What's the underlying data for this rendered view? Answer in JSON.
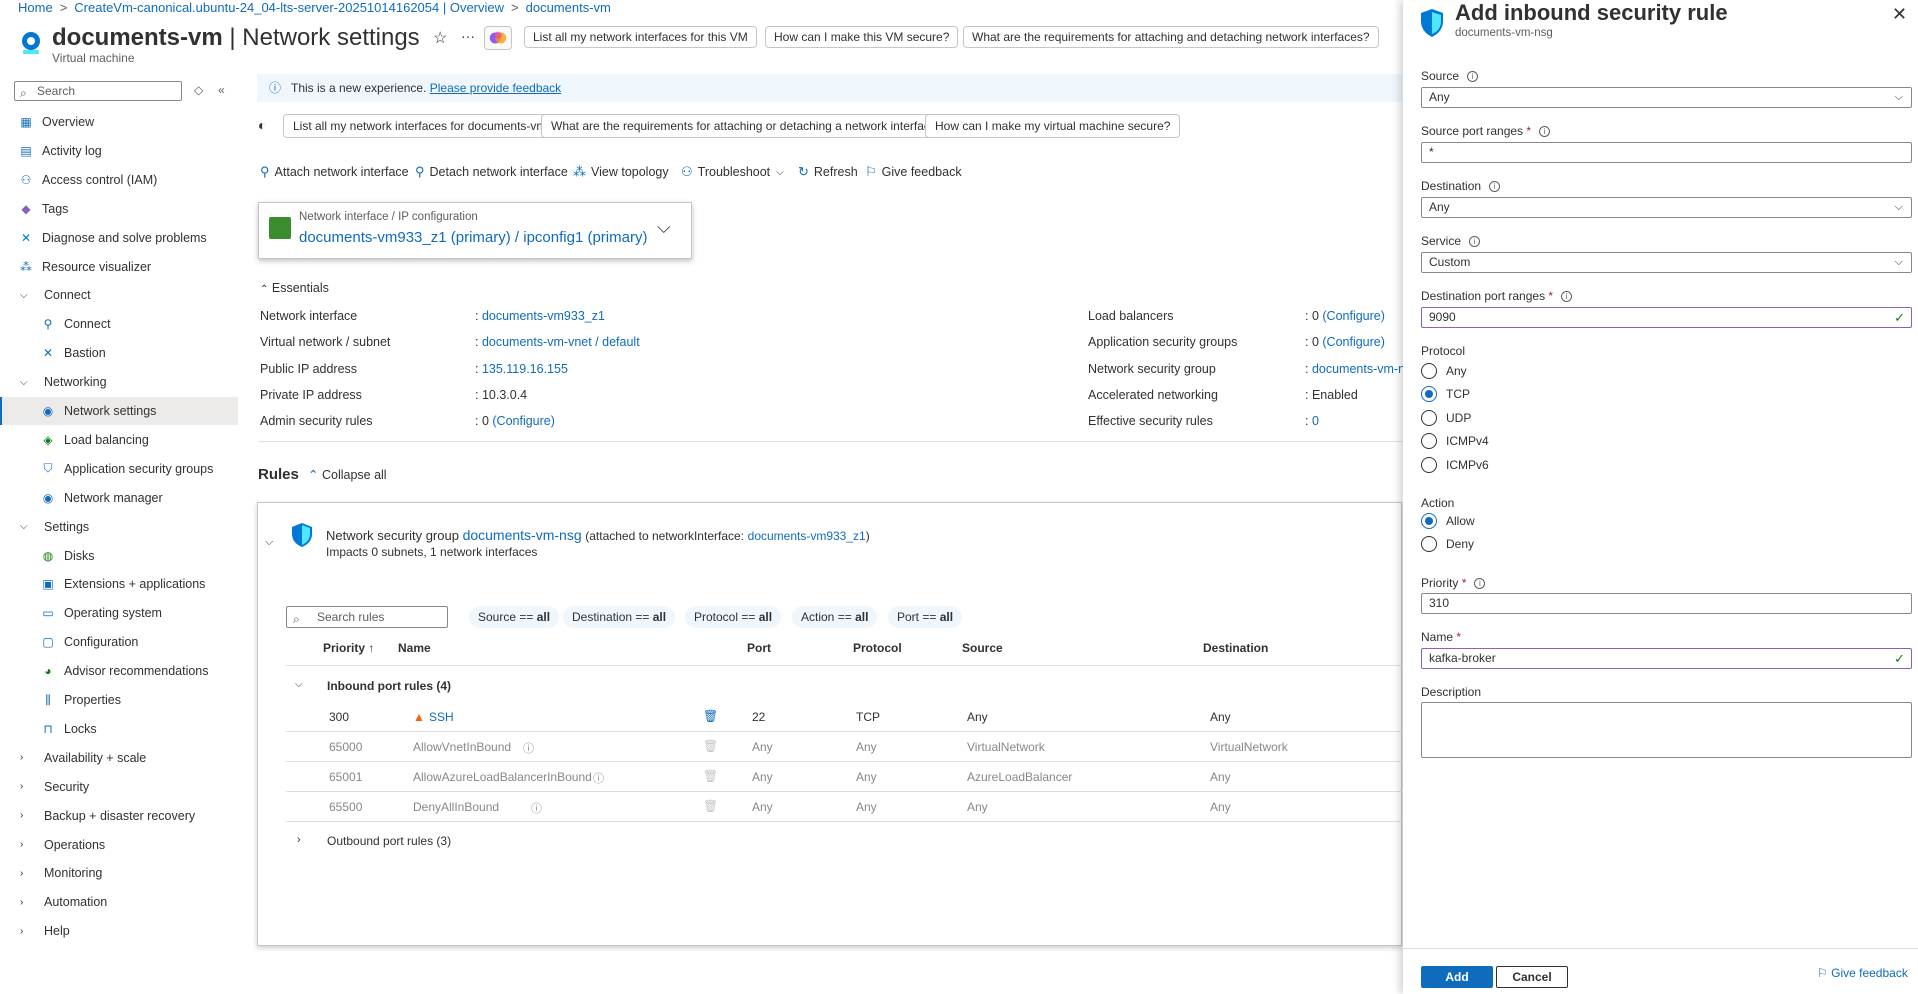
{
  "breadcrumb": [
    "Home",
    "CreateVm-canonical.ubuntu-24_04-lts-server-20251014162054 | Overview",
    "documents-vm"
  ],
  "header": {
    "resource": "documents-vm",
    "separator": "|",
    "page": "Network settings",
    "subtitle": "Virtual machine",
    "suggestions": [
      "List all my network interfaces for this VM",
      "How can I make this VM secure?",
      "What are the requirements for attaching and detaching network interfaces?"
    ]
  },
  "sidebar": {
    "search_placeholder": "Search",
    "items": [
      {
        "label": "Overview",
        "icon": "overview-icon",
        "indent": 0
      },
      {
        "label": "Activity log",
        "icon": "activity-log-icon",
        "indent": 0
      },
      {
        "label": "Access control (IAM)",
        "icon": "iam-icon",
        "indent": 0
      },
      {
        "label": "Tags",
        "icon": "tag-icon",
        "indent": 0
      },
      {
        "label": "Diagnose and solve problems",
        "icon": "diagnose-icon",
        "indent": 0
      },
      {
        "label": "Resource visualizer",
        "icon": "visualizer-icon",
        "indent": 0
      },
      {
        "label": "Connect",
        "group": true,
        "expanded": true
      },
      {
        "label": "Connect",
        "icon": "connect-icon",
        "indent": 1
      },
      {
        "label": "Bastion",
        "icon": "bastion-icon",
        "indent": 1
      },
      {
        "label": "Networking",
        "group": true,
        "expanded": true
      },
      {
        "label": "Network settings",
        "icon": "network-settings-icon",
        "indent": 1,
        "selected": true
      },
      {
        "label": "Load balancing",
        "icon": "load-balancing-icon",
        "indent": 1
      },
      {
        "label": "Application security groups",
        "icon": "asg-icon",
        "indent": 1
      },
      {
        "label": "Network manager",
        "icon": "network-manager-icon",
        "indent": 1
      },
      {
        "label": "Settings",
        "group": true,
        "expanded": true
      },
      {
        "label": "Disks",
        "icon": "disks-icon",
        "indent": 1
      },
      {
        "label": "Extensions + applications",
        "icon": "extensions-icon",
        "indent": 1
      },
      {
        "label": "Operating system",
        "icon": "os-icon",
        "indent": 1
      },
      {
        "label": "Configuration",
        "icon": "configuration-icon",
        "indent": 1
      },
      {
        "label": "Advisor recommendations",
        "icon": "advisor-icon",
        "indent": 1
      },
      {
        "label": "Properties",
        "icon": "properties-icon",
        "indent": 1
      },
      {
        "label": "Locks",
        "icon": "lock-icon",
        "indent": 1
      },
      {
        "label": "Availability + scale",
        "group": true,
        "expanded": false
      },
      {
        "label": "Security",
        "group": true,
        "expanded": false
      },
      {
        "label": "Backup + disaster recovery",
        "group": true,
        "expanded": false
      },
      {
        "label": "Operations",
        "group": true,
        "expanded": false
      },
      {
        "label": "Monitoring",
        "group": true,
        "expanded": false
      },
      {
        "label": "Automation",
        "group": true,
        "expanded": false
      },
      {
        "label": "Help",
        "group": true,
        "expanded": false
      }
    ]
  },
  "banner": {
    "text": "This is a new experience.",
    "link": "Please provide feedback"
  },
  "prompts": [
    "List all my network interfaces for documents-vm.",
    "What are the requirements for attaching or detaching a network interface?",
    "How can I make my virtual machine secure?"
  ],
  "toolbar": [
    "Attach network interface",
    "Detach network interface",
    "View topology",
    "Troubleshoot",
    "Refresh",
    "Give feedback"
  ],
  "nic": {
    "label": "Network interface / IP configuration",
    "value": "documents-vm933_z1 (primary) / ipconfig1 (primary)"
  },
  "essentials": {
    "title": "Essentials",
    "left": [
      {
        "label": "Network interface",
        "value": "documents-vm933_z1",
        "link": true
      },
      {
        "label": "Virtual network / subnet",
        "value": "documents-vm-vnet / default",
        "link": true
      },
      {
        "label": "Public IP address",
        "value": "135.119.16.155",
        "link": true
      },
      {
        "label": "Private IP address",
        "value": "10.3.0.4",
        "link": false
      },
      {
        "label": "Admin security rules",
        "value": "0",
        "extra": "(Configure)"
      }
    ],
    "right": [
      {
        "label": "Load balancers",
        "value": "0",
        "extra": "(Configure)"
      },
      {
        "label": "Application security groups",
        "value": "0",
        "extra": "(Configure)"
      },
      {
        "label": "Network security group",
        "value": "documents-vm-ns",
        "link": true
      },
      {
        "label": "Accelerated networking",
        "value": "Enabled",
        "link": false
      },
      {
        "label": "Effective security rules",
        "value": "0",
        "link": true
      }
    ]
  },
  "rules": {
    "title": "Rules",
    "collapse_all": "Collapse all",
    "nsg_prefix": "Network security group",
    "nsg_name": "documents-vm-nsg",
    "nsg_attached_prefix": "(attached to networkInterface:",
    "nsg_attached_nic": "documents-vm933_z1",
    "nsg_attached_suffix": ")",
    "impacts": "Impacts 0 subnets, 1 network interfaces",
    "search_placeholder": "Search rules",
    "filters": [
      {
        "key": "Source",
        "op": "==",
        "val": "all"
      },
      {
        "key": "Destination",
        "op": "==",
        "val": "all"
      },
      {
        "key": "Protocol",
        "op": "==",
        "val": "all"
      },
      {
        "key": "Action",
        "op": "==",
        "val": "all"
      },
      {
        "key": "Port",
        "op": "==",
        "val": "all"
      }
    ],
    "columns": [
      "Priority ↑",
      "Name",
      "Port",
      "Protocol",
      "Source",
      "Destination"
    ],
    "inbound_label": "Inbound port rules (4)",
    "inbound": [
      {
        "priority": "300",
        "name": "SSH",
        "port": "22",
        "protocol": "TCP",
        "source": "Any",
        "destination": "Any",
        "warning": true,
        "default": false
      },
      {
        "priority": "65000",
        "name": "AllowVnetInBound",
        "port": "Any",
        "protocol": "Any",
        "source": "VirtualNetwork",
        "destination": "VirtualNetwork",
        "default": true
      },
      {
        "priority": "65001",
        "name": "AllowAzureLoadBalancerInBound",
        "port": "Any",
        "protocol": "Any",
        "source": "AzureLoadBalancer",
        "destination": "Any",
        "default": true
      },
      {
        "priority": "65500",
        "name": "DenyAllInBound",
        "port": "Any",
        "protocol": "Any",
        "source": "Any",
        "destination": "Any",
        "default": true
      }
    ],
    "outbound_label": "Outbound port rules (3)"
  },
  "panel": {
    "title": "Add inbound security rule",
    "subtitle": "documents-vm-nsg",
    "source_label": "Source",
    "source_value": "Any",
    "source_ports_label": "Source port ranges",
    "source_ports_value": "*",
    "destination_label": "Destination",
    "destination_value": "Any",
    "service_label": "Service",
    "service_value": "Custom",
    "dest_ports_label": "Destination port ranges",
    "dest_ports_value": "9090",
    "protocol_label": "Protocol",
    "protocol_options": [
      "Any",
      "TCP",
      "UDP",
      "ICMPv4",
      "ICMPv6"
    ],
    "protocol_selected": "TCP",
    "action_label": "Action",
    "action_options": [
      "Allow",
      "Deny"
    ],
    "action_selected": "Allow",
    "priority_label": "Priority",
    "priority_value": "310",
    "name_label": "Name",
    "name_value": "kafka-broker",
    "description_label": "Description",
    "add": "Add",
    "cancel": "Cancel",
    "feedback": "Give feedback"
  },
  "colors": {
    "accent": "#0f6cbd",
    "selected_bar": "#0f6cbd",
    "valid": "#107c10",
    "required": "#a4262c",
    "warning": "#f7630c"
  }
}
